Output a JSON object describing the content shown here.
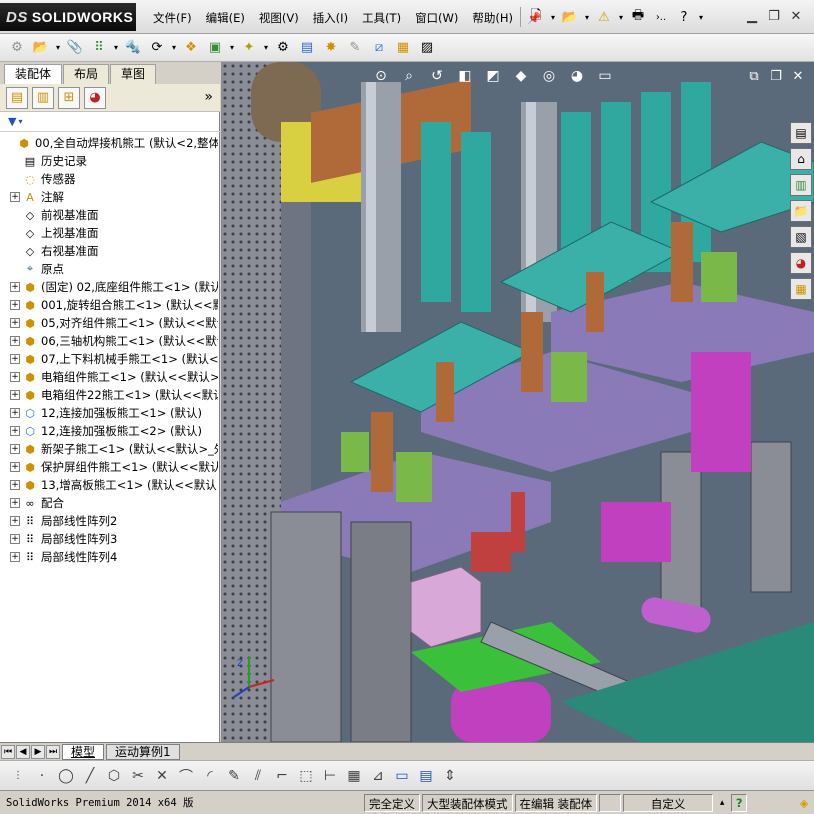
{
  "app": {
    "logo_prefix": "DS",
    "logo": "SOLIDWORKS"
  },
  "menu": [
    "文件(F)",
    "编辑(E)",
    "视图(V)",
    "插入(I)",
    "工具(T)",
    "窗口(W)",
    "帮助(H)"
  ],
  "top_right": {
    "overflow": "›.."
  },
  "panel": {
    "tabs": [
      "装配体",
      "布局",
      "草图"
    ],
    "expand_symbol": "»"
  },
  "tree": [
    {
      "label": "00,全自动焊接机熊工  (默认<2,整体",
      "icon": "assembly-icon",
      "expand": ""
    },
    {
      "label": "历史记录",
      "icon": "history-icon",
      "expand": "",
      "indent": 1
    },
    {
      "label": "传感器",
      "icon": "sensor-icon",
      "expand": "",
      "indent": 1
    },
    {
      "label": "注解",
      "icon": "annotation-icon",
      "expand": "+",
      "indent": 1
    },
    {
      "label": "前视基准面",
      "icon": "plane-icon",
      "expand": "",
      "indent": 1
    },
    {
      "label": "上视基准面",
      "icon": "plane-icon",
      "expand": "",
      "indent": 1
    },
    {
      "label": "右视基准面",
      "icon": "plane-icon",
      "expand": "",
      "indent": 1
    },
    {
      "label": "原点",
      "icon": "origin-icon",
      "expand": "",
      "indent": 1
    },
    {
      "label": "(固定) 02,底座组件熊工<1> (默认",
      "icon": "assembly-icon",
      "expand": "+",
      "indent": 1
    },
    {
      "label": "001,旋转组合熊工<1> (默认<<默",
      "icon": "assembly-icon",
      "expand": "+",
      "indent": 1
    },
    {
      "label": "05,对齐组件熊工<1> (默认<<默认",
      "icon": "assembly-icon",
      "expand": "+",
      "indent": 1
    },
    {
      "label": "06,三轴机构熊工<1> (默认<<默认",
      "icon": "assembly-icon",
      "expand": "+",
      "indent": 1
    },
    {
      "label": "07,上下料机械手熊工<1> (默认<",
      "icon": "assembly-icon",
      "expand": "+",
      "indent": 1
    },
    {
      "label": "电箱组件熊工<1> (默认<<默认>_",
      "icon": "assembly-icon",
      "expand": "+",
      "indent": 1
    },
    {
      "label": "电箱组件22熊工<1> (默认<<默认",
      "icon": "assembly-icon",
      "expand": "+",
      "indent": 1
    },
    {
      "label": "12,连接加强板熊工<1> (默认)",
      "icon": "part-icon",
      "expand": "+",
      "indent": 1
    },
    {
      "label": "12,连接加强板熊工<2> (默认)",
      "icon": "part-icon",
      "expand": "+",
      "indent": 1
    },
    {
      "label": "新架子熊工<1> (默认<<默认>_外",
      "icon": "assembly-icon",
      "expand": "+",
      "indent": 1
    },
    {
      "label": "保护屏组件熊工<1> (默认<<默认",
      "icon": "assembly-icon",
      "expand": "+",
      "indent": 1
    },
    {
      "label": "13,增高板熊工<1> (默认<<默认>",
      "icon": "assembly-icon",
      "expand": "+",
      "indent": 1
    },
    {
      "label": "配合",
      "icon": "mates-icon",
      "expand": "+",
      "indent": 1
    },
    {
      "label": "局部线性阵列2",
      "icon": "pattern-icon",
      "expand": "+",
      "indent": 1
    },
    {
      "label": "局部线性阵列3",
      "icon": "pattern-icon",
      "expand": "+",
      "indent": 1
    },
    {
      "label": "局部线性阵列4",
      "icon": "pattern-icon",
      "expand": "+",
      "indent": 1
    }
  ],
  "bottom_tabs": [
    "模型",
    "运动算例1"
  ],
  "status": {
    "product": "SolidWorks Premium 2014 x64 版",
    "definition": "完全定义",
    "mode": "大型装配体模式",
    "editing": "在编辑 装配体",
    "units": "自定义",
    "help": "?"
  },
  "colors": {
    "plate_teal": "#3ab0a8",
    "plate_purple": "#8a7ab8",
    "frame_gray": "#8a8c96",
    "green_block": "#7ab84a",
    "yellow_block": "#d8d040",
    "magenta": "#c040c0",
    "copper": "#b06a3a"
  }
}
